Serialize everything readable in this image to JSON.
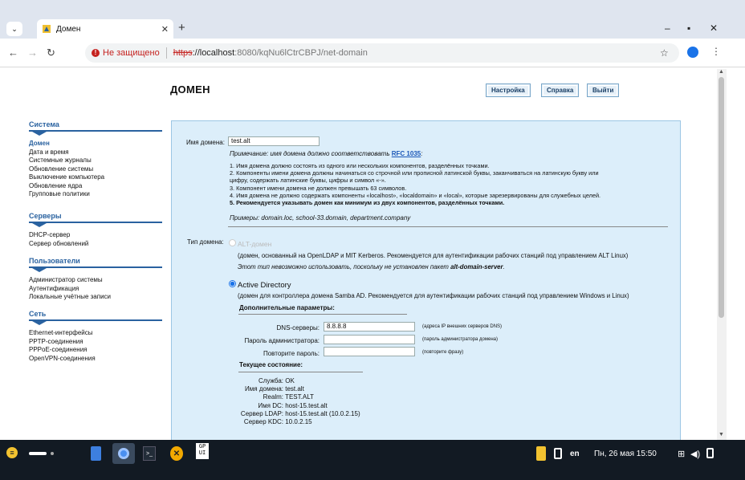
{
  "browser": {
    "tab_title": "Домен",
    "new_tab": "+",
    "minimize": "–",
    "maximize": "▪",
    "close": "✕",
    "not_secure": "Не защищено",
    "url_scheme": "https",
    "url_host": "://localhost",
    "url_path": ":8080/kqNu6lCtrCBPJ/net-domain"
  },
  "page": {
    "title": "ДОМЕН",
    "buttons": {
      "settings": "Настройка",
      "help": "Справка",
      "logout": "Выйти"
    }
  },
  "sidebar": {
    "groups": [
      {
        "title": "Система",
        "items": [
          "Домен",
          "Дата и время",
          "Системные журналы",
          "Обновление системы",
          "Выключение компьютера",
          "Обновление ядра",
          "Групповые политики"
        ]
      },
      {
        "title": "Серверы",
        "items": [
          "DHCP-сервер",
          "Сервер обновлений"
        ]
      },
      {
        "title": "Пользователи",
        "items": [
          "Администратор системы",
          "Аутентификация",
          "Локальные учётные записи"
        ]
      },
      {
        "title": "Сеть",
        "items": [
          "Ethernet-интерфейсы",
          "PPTP-соединения",
          "PPPoE-соединения",
          "OpenVPN-соединения"
        ]
      }
    ]
  },
  "form": {
    "domain_label": "Имя домена:",
    "domain_value": "test.alt",
    "note_prefix": "Примечание: имя домена должно соответствовать ",
    "note_link": "RFC 1035",
    "note_suffix": ":",
    "rules": [
      "1. Имя домена должно состоять из одного или нескольких компонентов, разделённых точками.",
      "2. Компоненты имени домена должны начинаться со строчной или прописной латинской буквы, заканчиваться на латинскую букву или",
      "цифру, содержать латинские буквы, цифры и символ «-».",
      "3. Компонент имени домена не должен превышать 63 символов.",
      "4. Имя домена не должно содержать компоненты «localhost», «localdomain» и «local», которые зарезервированы для служебных целей."
    ],
    "rule5": "5. Рекомендуется указывать домен как минимум из двух компонентов, разделённых точками.",
    "examples": "Примеры: domain.loc, school-33.domain, department.company",
    "type_label": "Тип домена:",
    "alt_domain": "ALT-домен",
    "alt_desc": "(домен, основанный на OpenLDAP и MIT Kerberos. Рекомендуется для аутентификации рабочих станций под управлением ALT Linux)",
    "alt_warn_prefix": "Этот тип невозможно использовать, поскольку не установлен пакет ",
    "alt_warn_pkg": "alt-domain-server",
    "alt_warn_suffix": ".",
    "ad": "Active Directory",
    "ad_desc": "(домен для контроллера домена Samba AD. Рекомендуется для аутентификации рабочих станций под управлением Windows и Linux)",
    "extra_title": "Дополнительные параметры:",
    "dns_label": "DNS-серверы:",
    "dns_value": "8.8.8.8",
    "dns_hint": "(адреса IP внешних серверов DNS)",
    "admin_pw_label": "Пароль администратора:",
    "admin_pw_hint": "(пароль администратора домена)",
    "repeat_label": "Повторите пароль:",
    "repeat_hint": "(повторите фразу)",
    "state_title": "Текущее состояние:",
    "state": [
      {
        "k": "Служба:",
        "v": "OK"
      },
      {
        "k": "Имя домена:",
        "v": "test.alt"
      },
      {
        "k": "Realm:",
        "v": "TEST.ALT"
      },
      {
        "k": "Имя DC:",
        "v": "host-15.test.alt"
      },
      {
        "k": "Сервер LDAP:",
        "v": "host-15.test.alt (10.0.2.15)"
      },
      {
        "k": "Сервер KDC:",
        "v": "10.0.2.15"
      }
    ]
  },
  "taskbar": {
    "gpui": "GP\nUI",
    "lang": "en",
    "datetime": "Пн, 26 мая 15:50"
  }
}
